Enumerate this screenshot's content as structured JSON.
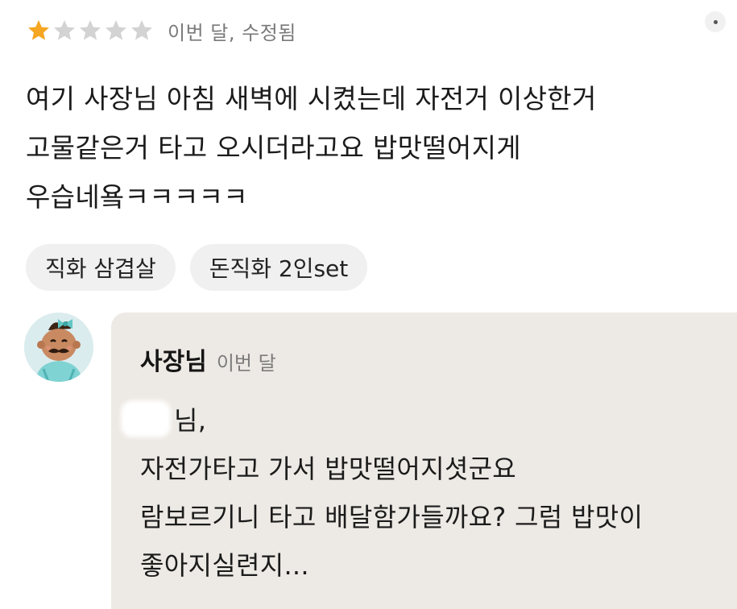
{
  "review": {
    "rating": 1,
    "max_rating": 5,
    "meta": "이번 달, 수정됨",
    "star_color": "#f5a623",
    "star_empty_color": "#d3d3d3",
    "lines": [
      "여기 사장님 아침 새벽에 시켰는데 자전거 이상한거",
      "고물같은거 타고 오시더라고요 밥맛떨어지게",
      "우습네욬ㅋㅋㅋㅋㅋ"
    ]
  },
  "menu_items": [
    "직화 삼겹살",
    "돈직화 2인set"
  ],
  "reply": {
    "owner_name": "사장님",
    "date": "이번 달",
    "greeting": "님,",
    "lines": [
      "자전가타고 가서 밥맛떨어지셧군요",
      "람보르기니 타고 배달함가들까요? 그럼 밥맛이",
      "좋아지실련지..."
    ],
    "background": "#ede9e4"
  }
}
